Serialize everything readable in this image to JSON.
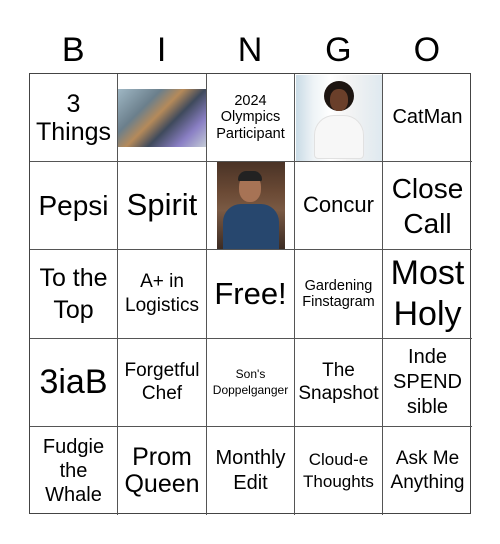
{
  "header": {
    "letters": [
      "B",
      "I",
      "N",
      "G",
      "O"
    ]
  },
  "board": {
    "cells": [
      {
        "type": "text",
        "text": "3\nThings"
      },
      {
        "type": "image",
        "alt": "group-photo-people-at-event"
      },
      {
        "type": "text",
        "text": "2024 Olympics Participant"
      },
      {
        "type": "image",
        "alt": "portrait-smiling-woman"
      },
      {
        "type": "text",
        "text": "CatMan"
      },
      {
        "type": "text",
        "text": "Pepsi"
      },
      {
        "type": "text",
        "text": "Spirit"
      },
      {
        "type": "image",
        "alt": "portrait-man-blue-shirt"
      },
      {
        "type": "text",
        "text": "Concur"
      },
      {
        "type": "text",
        "text": "Close Call"
      },
      {
        "type": "text",
        "text": "To the Top"
      },
      {
        "type": "text",
        "text": "A+ in Logistics"
      },
      {
        "type": "text",
        "text": "Free!"
      },
      {
        "type": "text",
        "text": "Gardening Finstagram"
      },
      {
        "type": "text",
        "text": "Most Holy"
      },
      {
        "type": "text",
        "text": "3iaB"
      },
      {
        "type": "text",
        "text": "Forgetful Chef"
      },
      {
        "type": "text",
        "text": "Son's Doppelganger"
      },
      {
        "type": "text",
        "text": "The Snapshot"
      },
      {
        "type": "text",
        "text": "Inde SPEND sible"
      },
      {
        "type": "text",
        "text": "Fudgie the Whale"
      },
      {
        "type": "text",
        "text": "Prom Queen"
      },
      {
        "type": "text",
        "text": "Monthly Edit"
      },
      {
        "type": "text",
        "text": "Cloud-e Thoughts"
      },
      {
        "type": "text",
        "text": "Ask Me Anything"
      }
    ]
  }
}
